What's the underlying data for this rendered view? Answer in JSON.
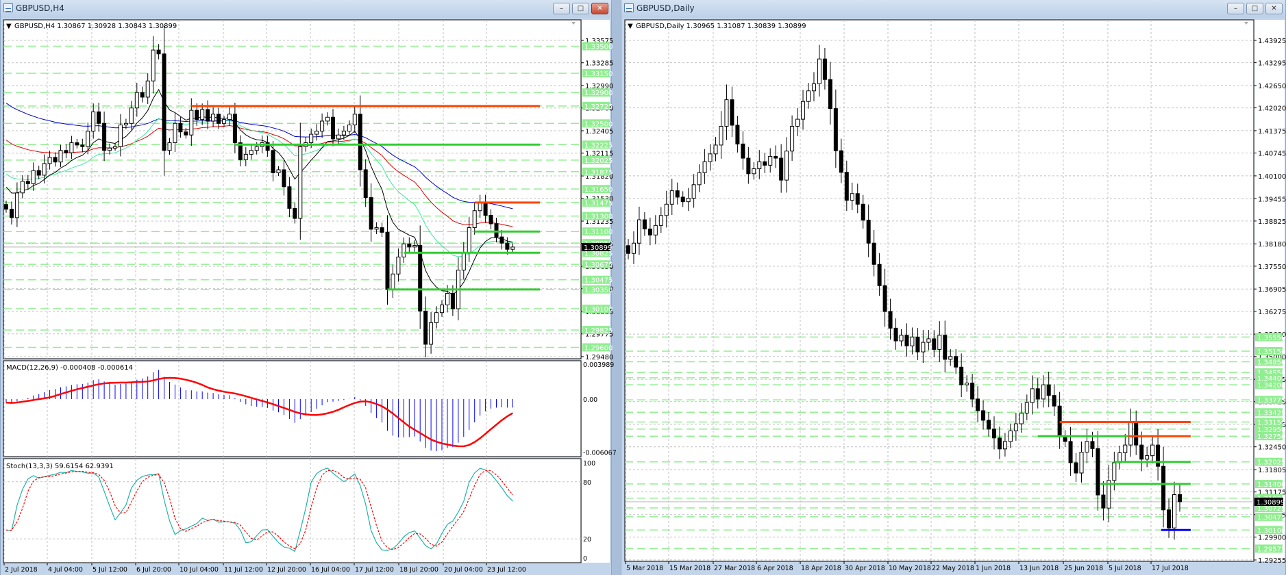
{
  "h4": {
    "window_title": "GBPUSD,H4",
    "buttons": {
      "minimize": "–",
      "maximize": "□",
      "close": "✕"
    },
    "header": "GBPUSD,H4  1.30867 1.30928 1.30843 1.30899",
    "macd_label": "MACD(12,26,9) -0.000408 -0.000614",
    "stoch_label": "Stoch(13,3,3) 59.6154 62.9391",
    "price_axis": [
      "1.33575",
      "1.33285",
      "1.32990",
      "1.32700",
      "1.32405",
      "1.32115",
      "1.31820",
      "1.31530",
      "1.31235",
      "1.30945",
      "1.30650",
      "1.30360",
      "1.30065",
      "1.29775",
      "1.29480"
    ],
    "level_labels": [
      "1.33500",
      "1.33150",
      "1.32900",
      "1.32725",
      "1.32500",
      "1.32225",
      "1.32025",
      "1.31875",
      "1.31650",
      "1.31475",
      "1.31300",
      "1.31100",
      "1.30950",
      "1.30825",
      "1.30675",
      "1.30475",
      "1.30350",
      "1.30100",
      "1.29825",
      "1.29600"
    ],
    "current_price": "1.30899",
    "macd_axis": [
      "0.003989",
      "0.00",
      "-0.006067"
    ],
    "stoch_axis": [
      "100",
      "80",
      "20",
      "0"
    ],
    "time_labels": [
      "2 Jul 2018",
      "4 Jul 04:00",
      "5 Jul 12:00",
      "6 Jul 20:00",
      "10 Jul 04:00",
      "11 Jul 12:00",
      "12 Jul 20:00",
      "16 Jul 04:00",
      "17 Jul 12:00",
      "18 Jul 20:00",
      "20 Jul 04:00",
      "23 Jul 12:00"
    ]
  },
  "daily": {
    "window_title": "GBPUSD,Daily",
    "buttons": {
      "minimize": "–",
      "maximize": "□",
      "close": "✕"
    },
    "header": "GBPUSD,Daily  1.30965 1.31087 1.30839 1.30899",
    "price_axis": [
      "1.43925",
      "1.43295",
      "1.42650",
      "1.42020",
      "1.41375",
      "1.40745",
      "1.40100",
      "1.39455",
      "1.38825",
      "1.38180",
      "1.37550",
      "1.36905",
      "1.36275",
      "1.35630",
      "1.35000",
      "1.34355",
      "1.33725",
      "1.33085",
      "1.32450",
      "1.31805",
      "1.31175",
      "1.30535",
      "1.29900",
      "1.29255"
    ],
    "level_labels": [
      "1.35550",
      "1.35150",
      "1.34850",
      "1.34550",
      "1.34400",
      "1.34200",
      "1.33775",
      "1.33425",
      "1.33150",
      "1.32950",
      "1.32750",
      "1.32025",
      "1.31400",
      "1.31000",
      "1.30725",
      "1.30475",
      "1.30100",
      "1.29575"
    ],
    "current_price": "1.30899",
    "time_labels": [
      "5 Mar 2018",
      "15 Mar 2018",
      "27 Mar 2018",
      "6 Apr 2018",
      "18 Apr 2018",
      "30 Apr 2018",
      "10 May 2018",
      "22 May 2018",
      "1 Jun 2018",
      "13 Jun 2018",
      "25 Jun 2018",
      "5 Jul 2018",
      "17 Jul 2018"
    ]
  },
  "colors": {
    "bull_fill": "#ffffff",
    "bear_fill": "#000000",
    "level_red": "#ff4500",
    "level_green": "#32cd32",
    "level_blue": "#0000ff",
    "level_dash": "#90ee90",
    "grid": "#c0c0c0",
    "ma_blue": "#0000cd",
    "ma_red": "#e00000",
    "ma_green": "#3ee8a0",
    "ma_black": "#000000",
    "macd_hist": "#0000ff",
    "macd_signal": "#ff0000",
    "stoch_k": "#20b2aa",
    "stoch_d": "#ff0000"
  },
  "chart_data": [
    {
      "type": "candlestick",
      "title": "GBPUSD,H4",
      "ylim": [
        1.29453,
        1.33841
      ],
      "grid": true,
      "closes": [
        1.3139,
        1.3128,
        1.316,
        1.3175,
        1.3172,
        1.3189,
        1.3183,
        1.3198,
        1.3206,
        1.32,
        1.3215,
        1.3212,
        1.3225,
        1.3222,
        1.322,
        1.324,
        1.3265,
        1.325,
        1.3215,
        1.3218,
        1.322,
        1.3248,
        1.325,
        1.327,
        1.329,
        1.3284,
        1.3305,
        1.3345,
        1.334,
        1.3215,
        1.3225,
        1.325,
        1.3239,
        1.3235,
        1.3267,
        1.3255,
        1.3268,
        1.3253,
        1.3262,
        1.325,
        1.3255,
        1.3262,
        1.3225,
        1.3203,
        1.321,
        1.3215,
        1.322,
        1.3225,
        1.3215,
        1.3186,
        1.319,
        1.3168,
        1.314,
        1.3127,
        1.322,
        1.3225,
        1.3236,
        1.324,
        1.3253,
        1.3258,
        1.323,
        1.3235,
        1.324,
        1.3248,
        1.3262,
        1.319,
        1.3154,
        1.3113,
        1.3115,
        1.3109,
        1.3035,
        1.3055,
        1.3077,
        1.3094,
        1.309,
        1.3092,
        1.3007,
        1.2964,
        1.2992,
        1.3005,
        1.3015,
        1.303,
        1.301,
        1.306,
        1.3083,
        1.3115,
        1.3137,
        1.3147,
        1.3131,
        1.312,
        1.3103,
        1.3095,
        1.3087,
        1.30899
      ],
      "moving_averages": [
        {
          "name": "MA long (blue)",
          "start": 1.3281,
          "period": 60,
          "color": "#0000cd"
        },
        {
          "name": "MA medium (red)",
          "start": 1.3233,
          "period": 40,
          "color": "#e00000"
        },
        {
          "name": "MA short (green)",
          "start": 1.3189,
          "period": 22,
          "color": "#3ee8a0"
        },
        {
          "name": "MA fast (black)",
          "start": 1.3175,
          "period": 9,
          "color": "#000000"
        }
      ],
      "levels": [
        {
          "price": 1.32725,
          "color": "red",
          "from": 34,
          "to": 98
        },
        {
          "price": 1.32225,
          "color": "green",
          "from": 42,
          "to": 98
        },
        {
          "price": 1.31475,
          "color": "red",
          "from": 86,
          "to": 98
        },
        {
          "price": 1.311,
          "color": "green",
          "from": 86,
          "to": 98
        },
        {
          "price": 1.30825,
          "color": "green",
          "from": 73,
          "to": 98
        },
        {
          "price": 1.3035,
          "color": "green",
          "from": 70,
          "to": 98
        }
      ],
      "macd": {
        "fast": 12,
        "slow": 26,
        "signal": 9,
        "ylim": [
          -0.00657,
          0.00438
        ]
      },
      "stochastic": {
        "k": 13,
        "d": 3,
        "slowing": 3,
        "ylim": [
          0,
          100
        ],
        "levels": [
          20,
          80
        ]
      }
    },
    {
      "type": "candlestick",
      "title": "GBPUSD,Daily",
      "ylim": [
        1.29216,
        1.44505
      ],
      "grid": true,
      "closes": [
        1.3791,
        1.382,
        1.3886,
        1.386,
        1.3843,
        1.387,
        1.3898,
        1.393,
        1.3968,
        1.395,
        1.3937,
        1.3947,
        1.3985,
        1.4019,
        1.405,
        1.4072,
        1.4097,
        1.415,
        1.4225,
        1.4153,
        1.41,
        1.406,
        1.4016,
        1.403,
        1.405,
        1.404,
        1.4065,
        1.406,
        1.3998,
        1.408,
        1.415,
        1.417,
        1.422,
        1.425,
        1.427,
        1.434,
        1.4282,
        1.42,
        1.4081,
        1.402,
        1.3941,
        1.396,
        1.393,
        1.3885,
        1.382,
        1.376,
        1.37,
        1.3627,
        1.358,
        1.3544,
        1.356,
        1.353,
        1.3555,
        1.3513,
        1.354,
        1.355,
        1.352,
        1.356,
        1.3492,
        1.35,
        1.347,
        1.342,
        1.3425,
        1.338,
        1.3347,
        1.332,
        1.3295,
        1.327,
        1.3239,
        1.326,
        1.329,
        1.331,
        1.334,
        1.337,
        1.3409,
        1.338,
        1.342,
        1.339,
        1.336,
        1.3275,
        1.326,
        1.32,
        1.3171,
        1.323,
        1.326,
        1.324,
        1.3109,
        1.3072,
        1.315,
        1.32,
        1.3228,
        1.325,
        1.3316,
        1.325,
        1.321,
        1.322,
        1.325,
        1.319,
        1.3067,
        1.3016,
        1.311,
        1.30899
      ],
      "levels": [
        {
          "price": 1.3315,
          "color": "red",
          "from": 79,
          "to": 103
        },
        {
          "price": 1.3275,
          "color": "green",
          "from": 75,
          "to": 91.5
        },
        {
          "price": 1.3275,
          "color": "red",
          "from": 91.5,
          "to": 103
        },
        {
          "price": 1.32025,
          "color": "green",
          "from": 89,
          "to": 103
        },
        {
          "price": 1.314,
          "color": "green",
          "from": 86.5,
          "to": 103
        },
        {
          "price": 1.301,
          "color": "blue",
          "from": 97.6,
          "to": 103
        }
      ]
    }
  ]
}
